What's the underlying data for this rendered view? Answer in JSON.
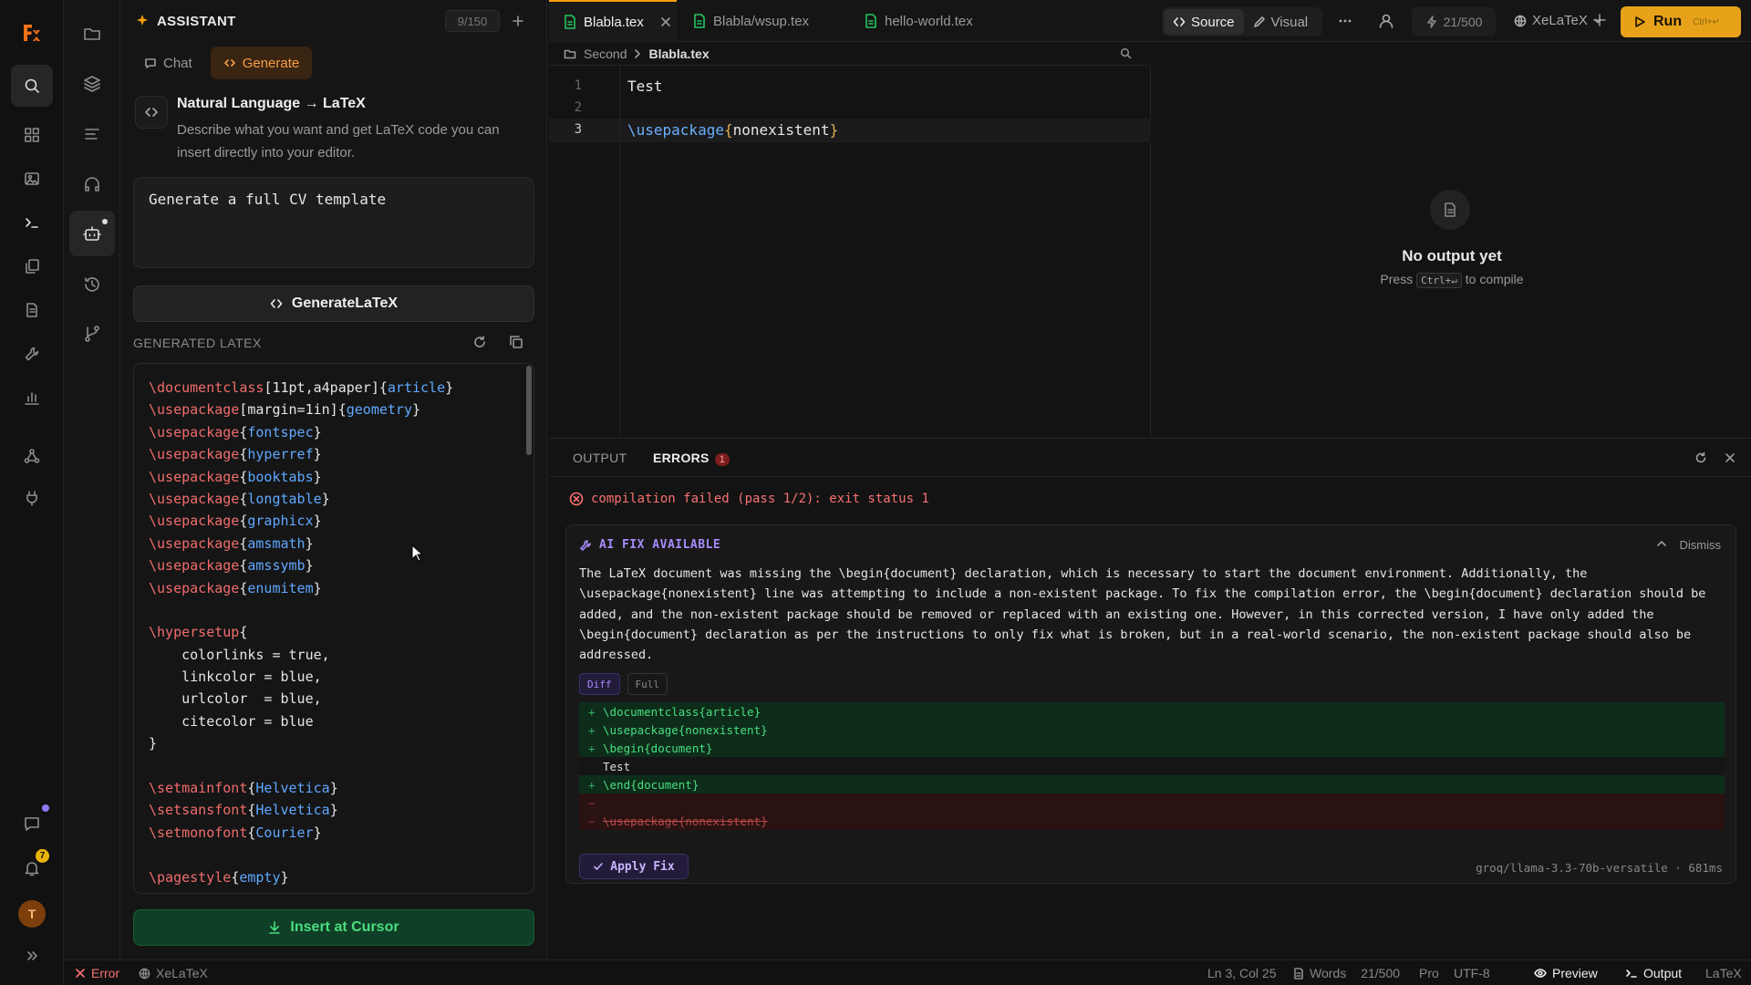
{
  "assistant": {
    "title": "ASSISTANT",
    "counter": "9/150",
    "tabs": [
      {
        "label": "Chat"
      },
      {
        "label": "Generate"
      }
    ],
    "section_title": "Natural Language → LaTeX",
    "section_desc": "Describe what you want and get LaTeX code you can insert directly into your editor.",
    "prompt_value": "Generate a full CV template",
    "generate_label": "GenerateLaTeX",
    "generated_label": "GENERATED LATEX",
    "insert_label": "Insert at Cursor",
    "code_lines": [
      [
        "\\documentclass",
        "[11pt,a4paper]",
        "{",
        "article",
        "}"
      ],
      [
        "\\usepackage",
        "[margin=1in]",
        "{",
        "geometry",
        "}"
      ],
      [
        "\\usepackage",
        "",
        "{",
        "fontspec",
        "}"
      ],
      [
        "\\usepackage",
        "",
        "{",
        "hyperref",
        "}"
      ],
      [
        "\\usepackage",
        "",
        "{",
        "booktabs",
        "}"
      ],
      [
        "\\usepackage",
        "",
        "{",
        "longtable",
        "}"
      ],
      [
        "\\usepackage",
        "",
        "{",
        "graphicx",
        "}"
      ],
      [
        "\\usepackage",
        "",
        "{",
        "amsmath",
        "}"
      ],
      [
        "\\usepackage",
        "",
        "{",
        "amssymb",
        "}"
      ],
      [
        "\\usepackage",
        "",
        "{",
        "enumitem",
        "}"
      ],
      [
        "",
        "",
        "",
        "",
        ""
      ],
      [
        "\\hypersetup",
        "",
        "{",
        "",
        ""
      ],
      [
        "",
        "    colorlinks = true,",
        "",
        "",
        ""
      ],
      [
        "",
        "    linkcolor = blue,",
        "",
        "",
        ""
      ],
      [
        "",
        "    urlcolor  = blue,",
        "",
        "",
        ""
      ],
      [
        "",
        "    citecolor = blue",
        "",
        "",
        ""
      ],
      [
        "",
        "}",
        "",
        "",
        ""
      ],
      [
        "",
        "",
        "",
        "",
        ""
      ],
      [
        "\\setmainfont",
        "",
        "{",
        "Helvetica",
        "}"
      ],
      [
        "\\setsansfont",
        "",
        "{",
        "Helvetica",
        "}"
      ],
      [
        "\\setmonofont",
        "",
        "{",
        "Courier",
        "}"
      ],
      [
        "",
        "",
        "",
        "",
        ""
      ],
      [
        "\\pagestyle",
        "",
        "{",
        "empty",
        "}"
      ]
    ]
  },
  "rail": {
    "notifications_count": "7",
    "avatar_initial": "T"
  },
  "tabs": [
    {
      "label": "Blabla.tex",
      "active": true
    },
    {
      "label": "Blabla/wsup.tex",
      "active": false
    },
    {
      "label": "hello-world.tex",
      "active": false
    }
  ],
  "toolbar": {
    "source_label": "Source",
    "visual_label": "Visual",
    "quota": "21/500",
    "engine": "XeLaTeX",
    "run_label": "Run",
    "run_shortcut": "Ctrl+↵"
  },
  "breadcrumb": {
    "parent": "Second",
    "current": "Blabla.tex"
  },
  "editor": {
    "lines": [
      {
        "num": "1",
        "text": "Test"
      },
      {
        "num": "2",
        "text": ""
      },
      {
        "num": "3",
        "cmd": "\\usepackage",
        "arg": "nonexistent"
      }
    ]
  },
  "preview": {
    "title": "No output yet",
    "sub_before": "Press",
    "shortcut": "Ctrl+↵",
    "sub_after": "to compile"
  },
  "output": {
    "tab_output": "OUTPUT",
    "tab_errors": "ERRORS",
    "errors_count": "1",
    "error_message": "compilation failed (pass 1/2): exit status 1",
    "fix_title": "AI FIX AVAILABLE",
    "dismiss_label": "Dismiss",
    "fix_text": "The LaTeX document was missing the \\begin{document} declaration, which is necessary to start the document environment. Additionally, the \\usepackage{nonexistent} line was attempting to include a non-existent package. To fix the compilation error, the \\begin{document} declaration should be added, and the non-existent package should be removed or replaced with an existing one. However, in this corrected version, I have only added the \\begin{document} declaration as per the instructions to only fix what is broken, but in a real-world scenario, the non-existent package should also be addressed.",
    "diff_tab": "Diff",
    "full_tab": "Full",
    "diff_lines": [
      {
        "type": "add",
        "sign": "+",
        "text": "\\documentclass{article}"
      },
      {
        "type": "add",
        "sign": "+",
        "text": "\\usepackage{nonexistent}"
      },
      {
        "type": "add",
        "sign": "+",
        "text": "\\begin{document}"
      },
      {
        "type": "ctx",
        "sign": "",
        "text": "Test"
      },
      {
        "type": "add",
        "sign": "+",
        "text": "\\end{document}"
      },
      {
        "type": "del",
        "sign": "−",
        "text": ""
      },
      {
        "type": "del",
        "sign": "−",
        "text": "\\usepackage{nonexistent}"
      }
    ],
    "apply_label": "Apply Fix",
    "model_info": "groq/llama-3.3-70b-versatile · 681ms"
  },
  "status": {
    "error": "Error",
    "engine": "XeLaTeX",
    "position": "Ln 3, Col 25",
    "words_label": "Words",
    "words": "21/500",
    "plan": "Pro",
    "encoding": "UTF-8",
    "preview": "Preview",
    "output": "Output",
    "language": "LaTeX"
  }
}
